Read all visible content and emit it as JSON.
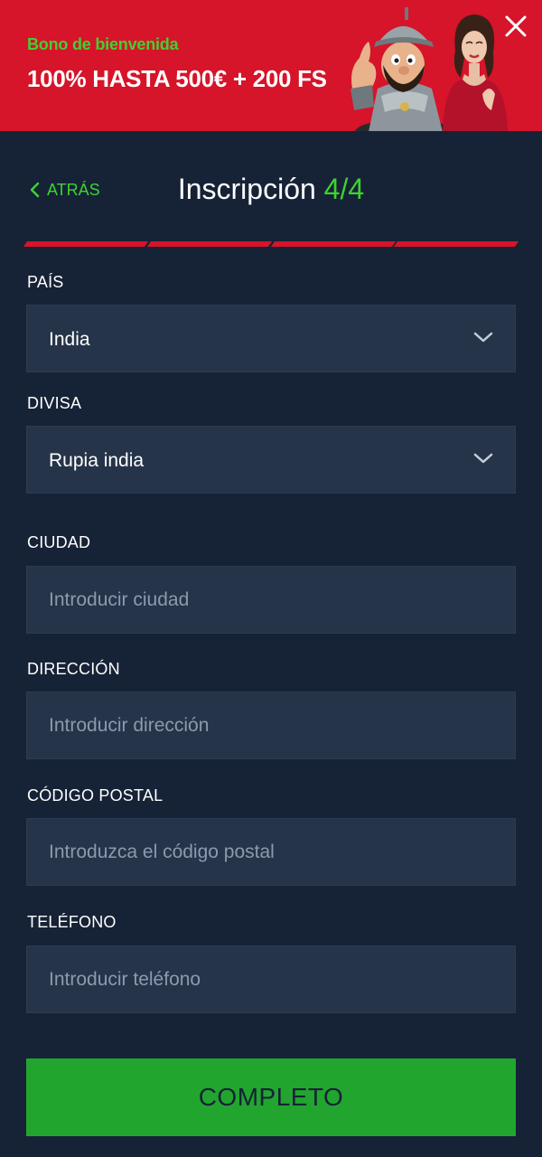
{
  "banner": {
    "subtitle": "Bono de bienvenida",
    "title": "100% HASTA 500€ + 200 FS"
  },
  "header": {
    "back_label": "ATRÁS",
    "title": "Inscripción",
    "step": "4/4"
  },
  "progress": {
    "steps_total": 4,
    "steps_done": 4
  },
  "form": {
    "country": {
      "label": "PAÍS",
      "value": "India"
    },
    "currency": {
      "label": "DIVISA",
      "value": "Rupia india"
    },
    "city": {
      "label": "CIUDAD",
      "placeholder": "Introducir ciudad"
    },
    "address": {
      "label": "DIRECCIÓN",
      "placeholder": "Introducir dirección"
    },
    "postal": {
      "label": "CÓDIGO POSTAL",
      "placeholder": "Introduzca el código postal"
    },
    "phone": {
      "label": "TELÉFONO",
      "placeholder": "Introducir teléfono"
    }
  },
  "submit_label": "COMPLETO",
  "colors": {
    "background": "#162236",
    "banner": "#d6142a",
    "accent_green": "#3fd232",
    "field_bg": "#26344a",
    "button": "#22a52f"
  },
  "icons": [
    "close-icon",
    "chevron-left-icon",
    "chevron-down-icon"
  ]
}
